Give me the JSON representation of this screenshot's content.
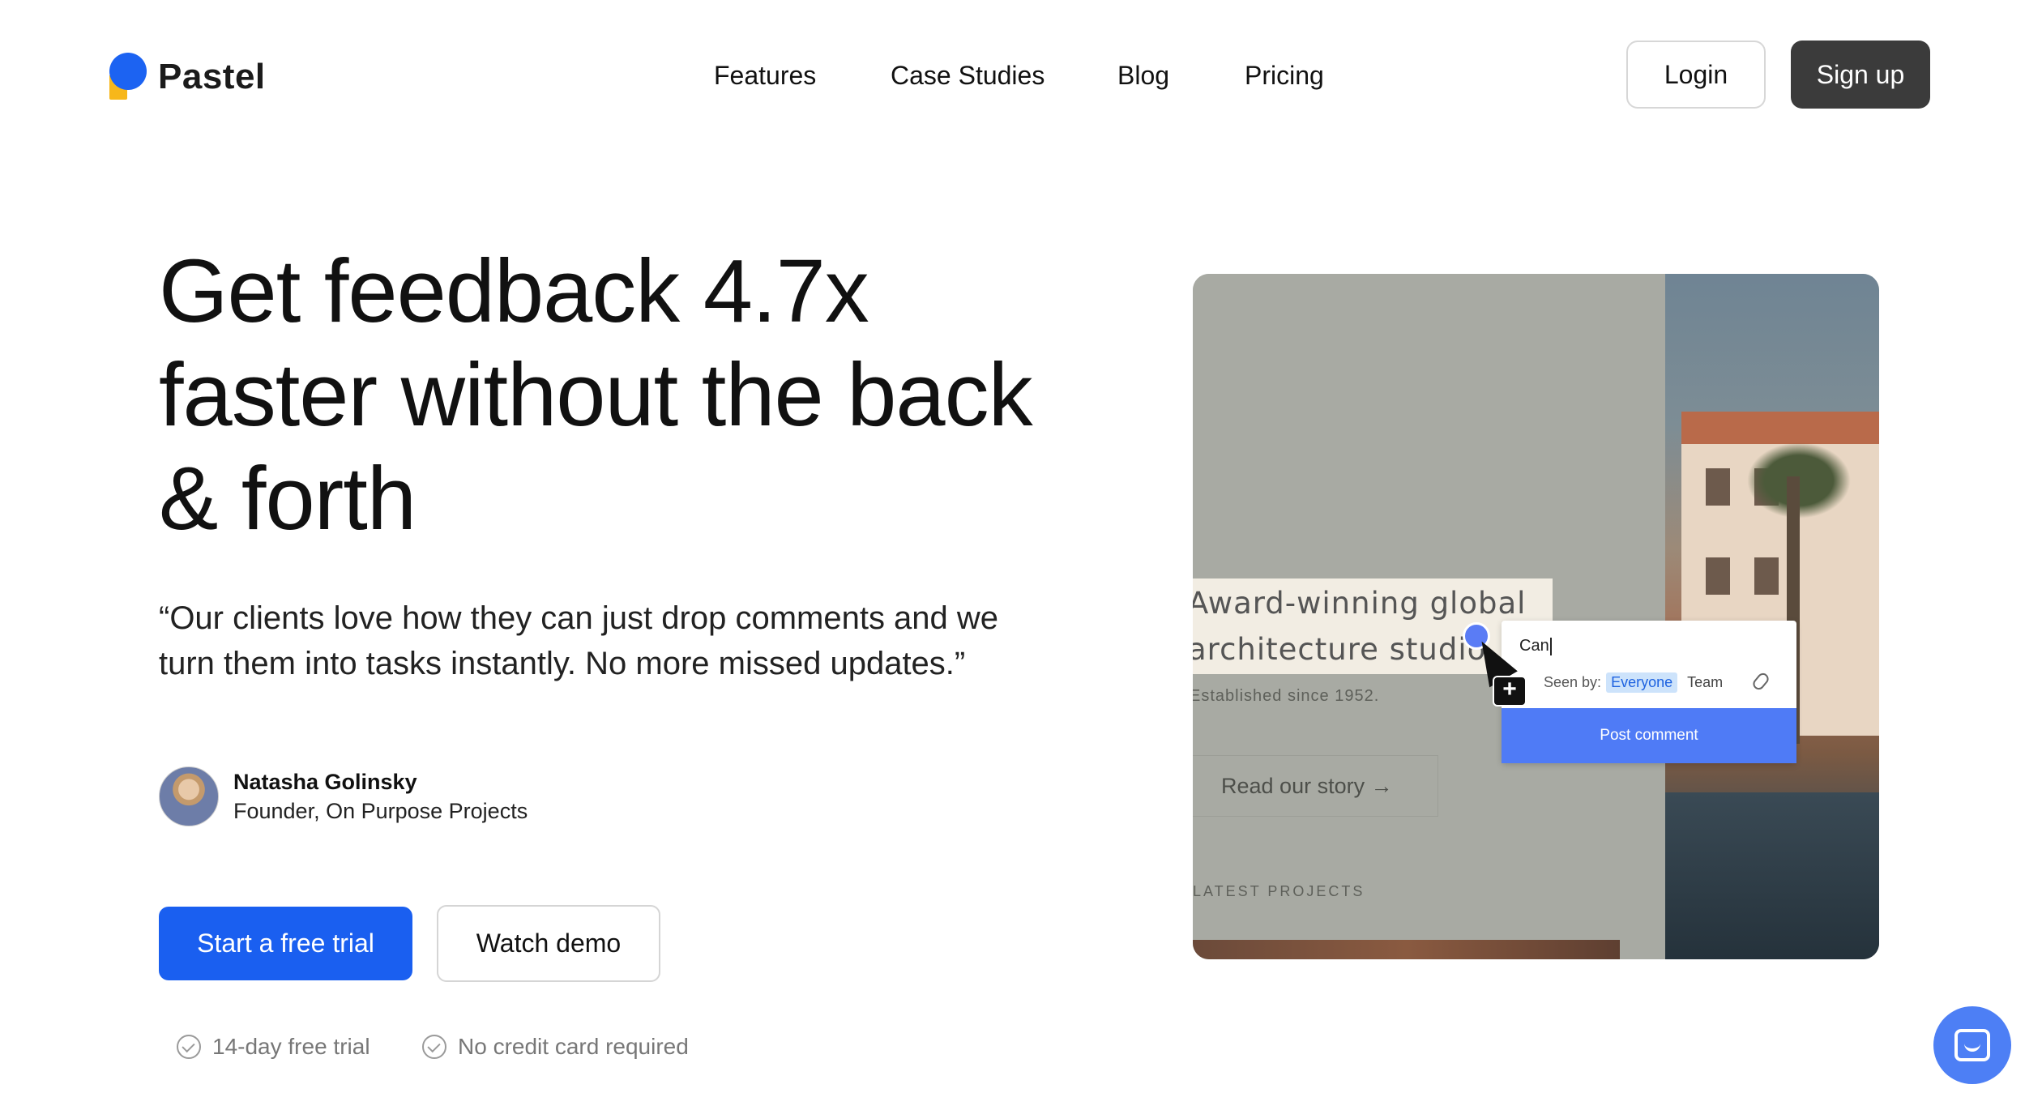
{
  "brand": {
    "name": "Pastel",
    "colors": {
      "primary": "#1a5ff0",
      "accent_yellow": "#f7b71a",
      "dark_button": "#3b3b3b"
    }
  },
  "nav": {
    "items": [
      {
        "label": "Features"
      },
      {
        "label": "Case Studies"
      },
      {
        "label": "Blog"
      },
      {
        "label": "Pricing"
      }
    ],
    "login_label": "Login",
    "signup_label": "Sign up"
  },
  "hero": {
    "headline": "Get feedback 4.7x faster without the back & forth",
    "quote": "“Our clients love how they can just drop comments and we turn them into tasks instantly. No more missed updates.”",
    "author": {
      "name": "Natasha Golinsky",
      "role": "Founder, On Purpose Projects"
    },
    "cta_primary": "Start a free trial",
    "cta_secondary": "Watch demo",
    "perks": [
      "14-day free trial",
      "No credit card required"
    ]
  },
  "preview": {
    "site_title": "Award-winning global architecture studio.",
    "site_title_line1": "Award-winning global",
    "site_title_line2": "architecture studio.",
    "established": "Established since 1952.",
    "read_story": "Read our story →",
    "latest_projects": "LATEST PROJECTS",
    "comment": {
      "draft_text": "Can",
      "seen_by_label": "Seen by:",
      "audience_selected": "Everyone",
      "audience_other": "Team",
      "post_label": "Post comment"
    }
  },
  "icons": {
    "check": "check-circle-icon",
    "chat": "chat-icon",
    "attach": "paperclip-icon",
    "cursor": "cursor-icon",
    "add_comment": "add-comment-icon"
  }
}
